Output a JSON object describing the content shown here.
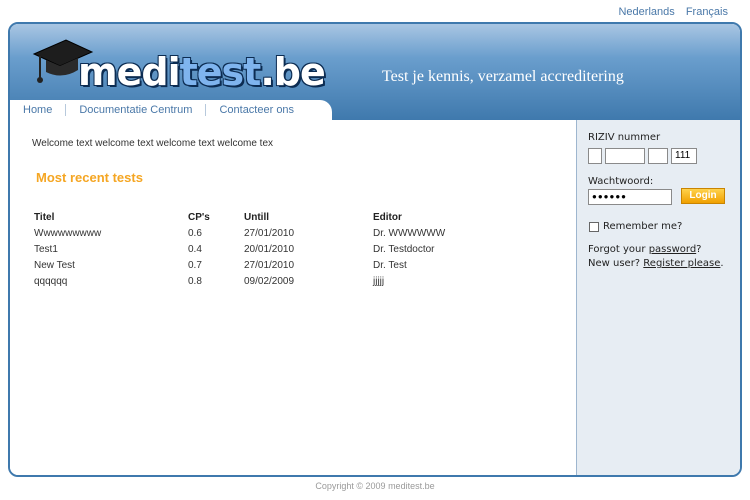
{
  "languages": [
    "Nederlands",
    "Français"
  ],
  "header": {
    "logo": {
      "part1": "medi",
      "part2": "test",
      "part3": ".be"
    },
    "tagline": "Test je kennis, verzamel accreditering"
  },
  "nav": [
    {
      "label": "Home"
    },
    {
      "label": "Documentatie Centrum"
    },
    {
      "label": "Contacteer ons"
    }
  ],
  "main": {
    "welcome": "Welcome text welcome text welcome text welcome tex",
    "recent_title": "Most recent tests",
    "columns": [
      "Titel",
      "CP's",
      "Untill",
      "Editor"
    ],
    "rows": [
      [
        "Wwwwwwwww",
        "0.6",
        "27/01/2010",
        "Dr. WWWWWW"
      ],
      [
        "Test1",
        "0.4",
        "20/01/2010",
        "Dr. Testdoctor"
      ],
      [
        "New Test",
        "0.7",
        "27/01/2010",
        "Dr. Test"
      ],
      [
        "qqqqqq",
        "0.8",
        "09/02/2009",
        "jjjjj"
      ]
    ]
  },
  "sidebar": {
    "riziv_label": "RIZIV nummer",
    "riziv_values": [
      "",
      "",
      "",
      "111"
    ],
    "password_label": "Wachtwoord:",
    "password_value": "●●●●●●",
    "login_label": "Login",
    "remember_label": "Remember me?",
    "forgot_prefix": "Forgot your ",
    "forgot_link": "password",
    "forgot_suffix": "?",
    "newuser_prefix": "New user? ",
    "newuser_link": "Register please",
    "newuser_suffix": "."
  },
  "footer": "Copyright © 2009 meditest.be",
  "colors": {
    "brand_blue": "#3f79ad",
    "accent_orange": "#f5a623",
    "sidebar_bg": "#e7edf3"
  }
}
